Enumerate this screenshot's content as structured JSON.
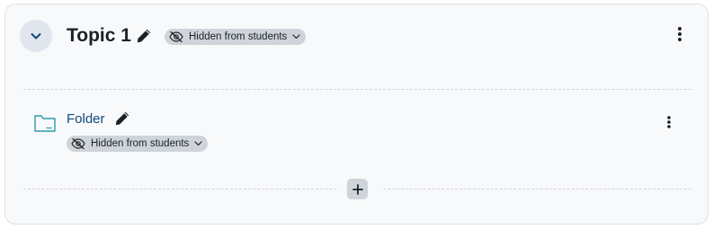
{
  "section": {
    "title": "Topic 1",
    "visibility_badge": "Hidden from students"
  },
  "activity": {
    "name": "Folder",
    "visibility_badge": "Hidden from students"
  },
  "icons": {
    "collapse": "chevron-down-icon",
    "edit": "pencil-icon",
    "visibility": "eye-slash-icon",
    "menu": "kebab-vertical-icon",
    "activity_type": "folder-icon",
    "add": "plus-icon"
  },
  "colors": {
    "card_background": "#f8f9fa",
    "badge_background": "#ced4da",
    "collapse_background": "#e1e6ee",
    "link": "#0f4a7a",
    "folder_icon": "#2a9bb0",
    "chevron": "#0f4a7a"
  }
}
